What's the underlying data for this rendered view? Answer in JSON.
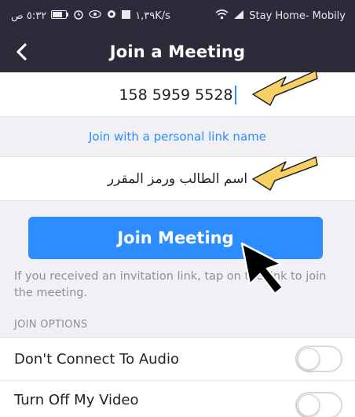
{
  "status_bar": {
    "time": "٥:٣٢ ص",
    "speed": "١,٣٩K/s",
    "carrier": "Stay Home- Mobily"
  },
  "nav": {
    "back_icon": "chevron-left-icon",
    "title": "Join a Meeting"
  },
  "meeting_id": {
    "value": "158 5959 5528"
  },
  "personal_link": {
    "label": "Join with a personal link name"
  },
  "name_field": {
    "value": "اسم الطالب ورمز المقرر"
  },
  "join_button": {
    "label": "Join Meeting"
  },
  "hint": {
    "text": "If you received an invitation link, tap on the link to join the meeting."
  },
  "join_options": {
    "section_label": "JOIN OPTIONS",
    "options": [
      {
        "label": "Don't Connect To Audio",
        "enabled": false
      },
      {
        "label": "Turn Off My Video",
        "enabled": false
      }
    ]
  },
  "colors": {
    "header_bg": "#2b2b39",
    "accent_blue": "#2d8cff",
    "annotation_arrow": "#f7cf62",
    "page_bg": "#f0f0f5"
  }
}
